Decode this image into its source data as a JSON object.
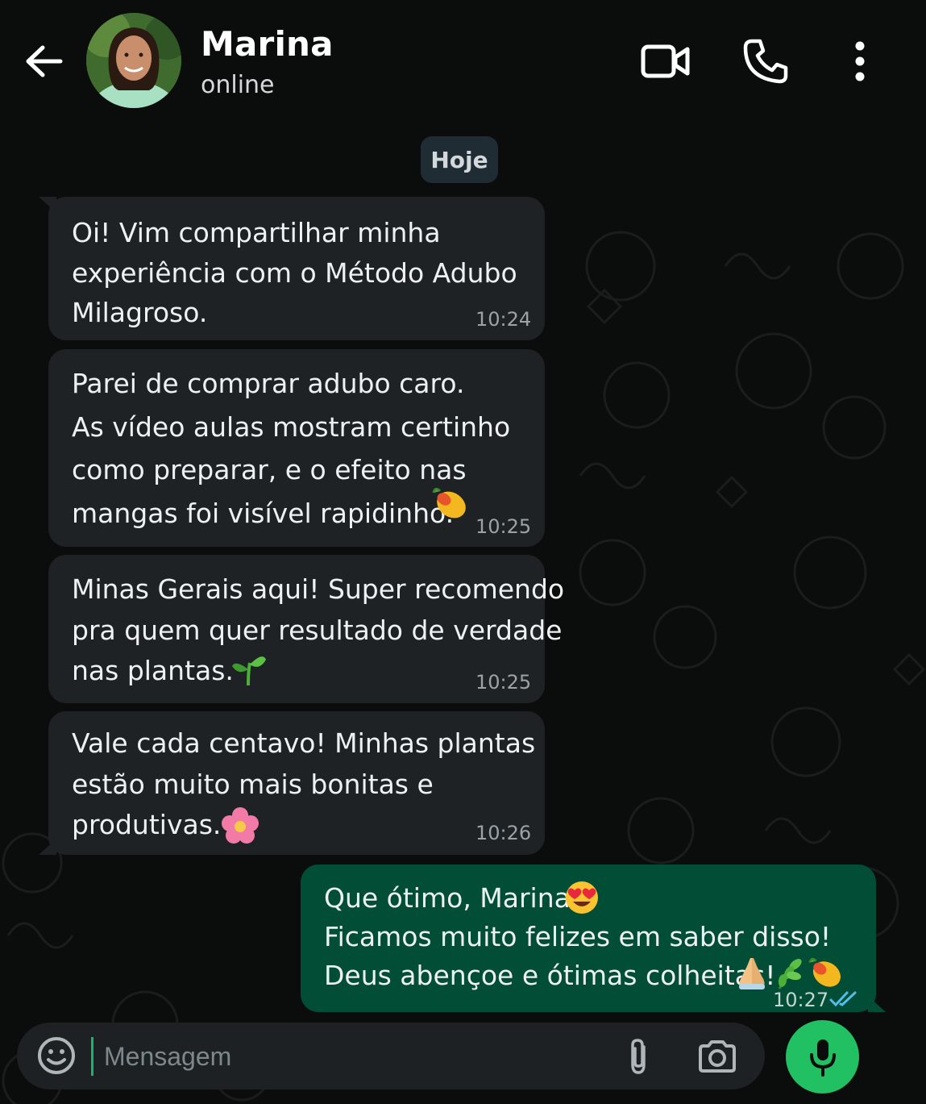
{
  "header": {
    "contact_name": "Marina",
    "status": "online"
  },
  "date_chip": "Hoje",
  "messages": [
    {
      "direction": "incoming",
      "lines": [
        "Oi! Vim compartilhar minha",
        "experiência com o Método Adubo",
        "Milagroso."
      ],
      "time": "10:24"
    },
    {
      "direction": "incoming",
      "lines": [
        "Parei de comprar adubo caro.",
        "As vídeo aulas mostram certinho",
        "como preparar, e o efeito nas",
        "mangas foi visível rapidinho."
      ],
      "trailing_emoji": "mango-emoji",
      "time": "10:25"
    },
    {
      "direction": "incoming",
      "lines": [
        "Minas Gerais aqui! Super recomendo",
        "pra quem quer resultado de verdade",
        "nas plantas."
      ],
      "trailing_emoji": "seedling-emoji",
      "time": "10:25"
    },
    {
      "direction": "incoming",
      "lines": [
        "Vale cada centavo! Minhas plantas",
        "estão muito mais bonitas e",
        "produtivas."
      ],
      "trailing_emoji": "flower-emoji",
      "time": "10:26"
    },
    {
      "direction": "outgoing",
      "lines": [
        "Que ótimo, Marina!",
        "Ficamos muito felizes em saber disso!",
        "Deus abençoe e ótimas colheitas!"
      ],
      "line_emojis": [
        "heart-eyes-emoji",
        "",
        "praying-hands-emoji herb-emoji mango-emoji"
      ],
      "time": "10:27",
      "receipt": "double-check-read"
    }
  ],
  "composer": {
    "placeholder": "Mensagem"
  },
  "icons": {
    "back": "arrow-left-icon",
    "video": "video-camera-icon",
    "call": "phone-icon",
    "menu": "more-vertical-icon",
    "emoji": "smiley-icon",
    "attach": "paperclip-icon",
    "camera": "camera-icon",
    "mic": "microphone-icon"
  },
  "colors": {
    "background": "#0b0d0c",
    "incoming_bubble": "#1f2224",
    "outgoing_bubble": "#024d36",
    "accent_green": "#21c063",
    "read_receipt": "#53bdeb"
  }
}
